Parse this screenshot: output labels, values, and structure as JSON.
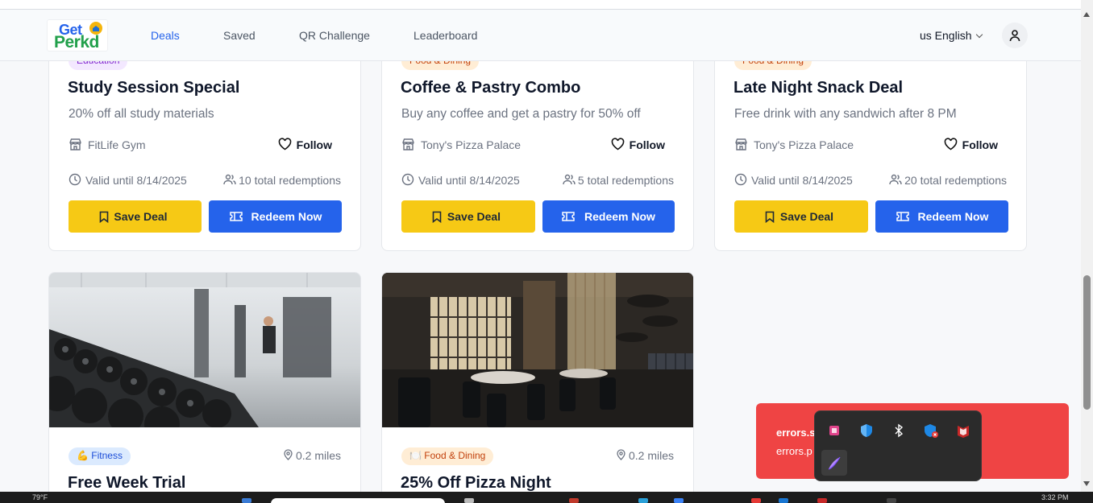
{
  "header": {
    "logo_line1": "Get",
    "logo_line2": "Perkd",
    "nav": [
      "Deals",
      "Saved",
      "QR Challenge",
      "Leaderboard"
    ],
    "language": "us English"
  },
  "deals_top": [
    {
      "category": "Education",
      "title": "Study Session Special",
      "description": "20% off all study materials",
      "merchant": "FitLife Gym",
      "follow_label": "Follow",
      "valid": "Valid until 8/14/2025",
      "redemptions": "10 total redemptions",
      "save_label": "Save Deal",
      "redeem_label": "Redeem Now"
    },
    {
      "category": "Food & Dining",
      "title": "Coffee & Pastry Combo",
      "description": "Buy any coffee and get a pastry for 50% off",
      "merchant": "Tony's Pizza Palace",
      "follow_label": "Follow",
      "valid": "Valid until 8/14/2025",
      "redemptions": "5 total redemptions",
      "save_label": "Save Deal",
      "redeem_label": "Redeem Now"
    },
    {
      "category": "Food & Dining",
      "title": "Late Night Snack Deal",
      "description": "Free drink with any sandwich after 8 PM",
      "merchant": "Tony's Pizza Palace",
      "follow_label": "Follow",
      "valid": "Valid until 8/14/2025",
      "redemptions": "20 total redemptions",
      "save_label": "Save Deal",
      "redeem_label": "Redeem Now"
    }
  ],
  "deals_bottom": [
    {
      "category_emoji": "💪",
      "category": "Fitness",
      "distance": "0.2 miles",
      "title": "Free Week Trial",
      "image": "gym-photo"
    },
    {
      "category_emoji": "🍽️",
      "category": "Food & Dining",
      "distance": "0.2 miles",
      "title": "25% Off Pizza Night",
      "image": "restaurant-photo"
    }
  ],
  "toast": {
    "line1": "errors.s",
    "line2": "errors.p"
  },
  "colors": {
    "primary": "#2563eb",
    "save": "#f6c915",
    "toast": "#ef4444",
    "education_pill": "#f3e8ff",
    "food_pill": "#ffedd5",
    "fitness_pill": "#dbeafe"
  },
  "tray_icons": [
    "image-app-icon",
    "defender-shield-icon",
    "bluetooth-icon",
    "security-warning-icon",
    "mcafee-icon",
    "pen-icon"
  ],
  "taskbar": {
    "left_text": "79°F",
    "time": "3:32 PM"
  }
}
